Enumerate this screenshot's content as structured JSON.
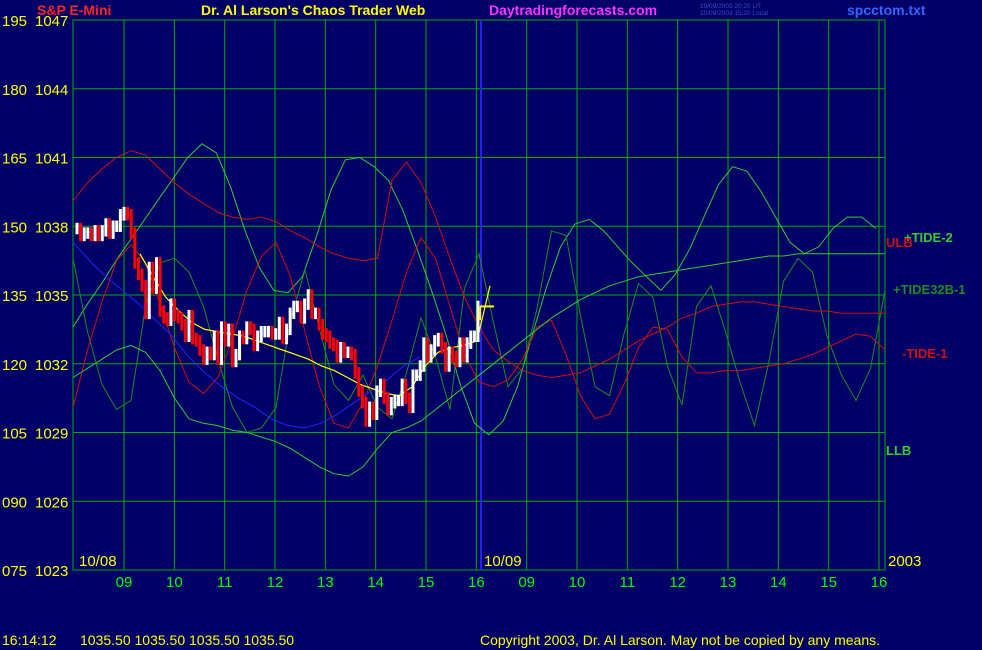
{
  "header": {
    "instrument": "S&P E-Mini",
    "title": "Dr. Al Larson's Chaos Trader Web",
    "site": "Daytradingforecasts.com",
    "timestamp_ut": "10/09/2003 20:20 UT",
    "timestamp_local": "10/09/2003 15:20 Local",
    "file": "spcctom.txt"
  },
  "footer": {
    "time": "16:14:12",
    "ohlc": "1035.50 1035.50 1035.50 1035.50",
    "copyright": "Copyright 2003, Dr. Al Larson. May not be copied by any means."
  },
  "colors": {
    "background": "#000066",
    "grid": "#00aa00",
    "axis_text": "#ffff00",
    "tick_text": "#00ff00",
    "price_up": "#ffffff",
    "price_down": "#ff0000",
    "tide_bright": "#33cc33",
    "tide_dark": "#1e8c1e",
    "ulb": "#cc1111",
    "today_line": "#2222ff",
    "instrument": "#ff2222",
    "site": "#ff33ff",
    "file": "#3366ff"
  },
  "chart_data": {
    "type": "line",
    "y_left_labels": [
      "195",
      "180",
      "165",
      "150",
      "135",
      "120",
      "105",
      "090",
      "075"
    ],
    "y_right_labels": [
      "1047",
      "1044",
      "1041",
      "1038",
      "1035",
      "1032",
      "1029",
      "1026",
      "1023"
    ],
    "ylim": [
      1023,
      1047
    ],
    "x_ticks": [
      "09",
      "10",
      "11",
      "12",
      "13",
      "14",
      "15",
      "16",
      "09",
      "10",
      "11",
      "12",
      "13",
      "14",
      "15",
      "16"
    ],
    "date_labels": [
      "10/08",
      "10/09"
    ],
    "year_label": "2003",
    "grid": true,
    "series": [
      {
        "name": "+TIDE-2",
        "color": "#33cc33",
        "values": [
          1033.6,
          1034.6,
          1035.5,
          1036.5,
          1037.4,
          1038.3,
          1039.2,
          1040.1,
          1041.0,
          1041.6,
          1041.2,
          1039.7,
          1037.8,
          1036.2,
          1035.2,
          1035.1,
          1035.8,
          1037.6,
          1039.6,
          1040.9,
          1041.0,
          1040.6,
          1040.0,
          1038.7,
          1037.0,
          1035.2,
          1033.3,
          1031.1,
          1029.4,
          1028.9,
          1029.5,
          1031.0,
          1033.2,
          1035.3,
          1037.1,
          1038.1,
          1038.3,
          1037.8,
          1037.1,
          1036.4,
          1035.8,
          1035.2,
          1035.9,
          1037.0,
          1038.4,
          1039.8,
          1040.6,
          1040.4,
          1039.5,
          1038.4,
          1037.3,
          1036.8,
          1037.1,
          1037.9,
          1038.4,
          1038.4,
          1037.9
        ]
      },
      {
        "name": "+TIDE32B-1",
        "color": "#1e8c1e",
        "values": [
          1036.6,
          1033.4,
          1031.1,
          1030.0,
          1030.4,
          1034.5,
          1036.4,
          1036.6,
          1036.0,
          1034.5,
          1032.2,
          1030.1,
          1029.0,
          1029.2,
          1030.1,
          1033.9,
          1036.1,
          1033.5,
          1031.1,
          1030.4,
          1031.5,
          1030.1,
          1029.6,
          1031.6,
          1034.0,
          1032.3,
          1030.0,
          1035.3,
          1036.8,
          1033.8,
          1031.0,
          1031.8,
          1034.4,
          1037.8,
          1037.6,
          1034.1,
          1031.0,
          1030.6,
          1033.3,
          1035.5,
          1034.9,
          1031.9,
          1030.2,
          1034.5,
          1035.4,
          1033.4,
          1031.2,
          1029.3,
          1032.1,
          1035.6,
          1036.6,
          1036.0,
          1033.2,
          1031.5,
          1030.4,
          1031.8,
          1035.2
        ]
      },
      {
        "name": "ULB",
        "color": "#cc1111",
        "values": [
          1039.1,
          1039.9,
          1040.5,
          1041.0,
          1041.3,
          1041.1,
          1040.5,
          1039.9,
          1039.4,
          1039.0,
          1038.6,
          1038.4,
          1038.3,
          1038.4,
          1038.2,
          1037.8,
          1037.5,
          1037.1,
          1036.8,
          1036.6,
          1036.5,
          1036.6,
          1040.0,
          1040.8,
          1039.9,
          1038.4,
          1036.6,
          1034.9,
          1033.6,
          1032.6,
          1032.1,
          1031.7,
          1031.5,
          1031.4,
          1031.5,
          1031.6,
          1031.9,
          1032.2,
          1032.6,
          1033.0,
          1033.3,
          1033.6,
          1034.0,
          1034.2,
          1034.5,
          1034.6,
          1034.7,
          1034.7,
          1034.6,
          1034.5,
          1034.4,
          1034.3,
          1034.3,
          1034.2,
          1034.2,
          1034.2,
          1034.2
        ]
      },
      {
        "name": "-TIDE-1",
        "color": "#cc1111",
        "values": [
          1030.1,
          1032.6,
          1034.7,
          1036.5,
          1037.2,
          1036.4,
          1034.6,
          1032.7,
          1031.2,
          1030.7,
          1031.4,
          1033.1,
          1035.2,
          1036.7,
          1037.3,
          1035.8,
          1033.4,
          1031.0,
          1029.4,
          1029.2,
          1030.3,
          1031.9,
          1033.9,
          1036.0,
          1037.5,
          1036.6,
          1034.5,
          1032.4,
          1031.2,
          1031.0,
          1031.3,
          1032.2,
          1033.6,
          1033.9,
          1032.4,
          1030.6,
          1029.6,
          1029.8,
          1031.1,
          1032.7,
          1033.6,
          1033.5,
          1032.3,
          1031.6,
          1031.6,
          1031.7,
          1031.7,
          1031.8,
          1031.9,
          1032.0,
          1032.2,
          1032.4,
          1032.7,
          1033.0,
          1033.3,
          1033.2,
          1032.6
        ]
      },
      {
        "name": "LLB",
        "color": "#33cc33",
        "values": [
          1031.4,
          1031.8,
          1032.2,
          1032.6,
          1032.8,
          1032.5,
          1031.7,
          1030.5,
          1029.6,
          1029.4,
          1029.3,
          1029.1,
          1029.0,
          1028.8,
          1028.6,
          1028.3,
          1027.9,
          1027.5,
          1027.2,
          1027.1,
          1027.5,
          1028.3,
          1029.0,
          1029.2,
          1029.5,
          1030.0,
          1030.5,
          1031.0,
          1031.5,
          1032.0,
          1032.5,
          1033.0,
          1033.5,
          1034.0,
          1034.4,
          1034.8,
          1035.1,
          1035.4,
          1035.6,
          1035.8,
          1035.9,
          1036.0,
          1036.1,
          1036.2,
          1036.3,
          1036.4,
          1036.5,
          1036.6,
          1036.7,
          1036.7,
          1036.8,
          1036.8,
          1036.8,
          1036.8,
          1036.8,
          1036.8,
          1036.8
        ]
      },
      {
        "name": "",
        "color": "#2222ff",
        "values": [
          1037.3,
          1036.5,
          1035.8,
          1035.2,
          1034.6,
          1033.9,
          1033.2,
          1032.3,
          1031.6,
          1031.0,
          1030.5,
          1030.1,
          1029.6,
          1029.3,
          1029.2,
          1029.4,
          1029.8,
          1030.3,
          1030.8,
          1031.3,
          1031.9,
          1032.3
        ]
      },
      {
        "name": "",
        "color": "#ffff00",
        "values": [
          1036.8,
          1035.8,
          1034.9,
          1034.3,
          1033.8,
          1033.5,
          1033.4,
          1033.3,
          1033.2,
          1033.0,
          1032.8,
          1032.6,
          1032.4,
          1032.2,
          1031.9,
          1031.7,
          1031.4,
          1031.1,
          1030.9,
          1030.7,
          1030.6,
          1031.0,
          1031.9,
          1032.5,
          1032.7,
          1032.8,
          1033.0,
          1035.4
        ]
      }
    ],
    "price_bars": {
      "up_color": "#ffffff",
      "down_color": "#ff0000",
      "closes": [
        1037.9,
        1037.6,
        1037.7,
        1037.7,
        1037.6,
        1037.8,
        1037.6,
        1037.8,
        1038.1,
        1037.7,
        1038.0,
        1038.0,
        1038.5,
        1038.6,
        1038.5,
        1037.7,
        1036.4,
        1035.9,
        1035.4,
        1034.2,
        1036.2,
        1035.3,
        1036.4,
        1034.3,
        1034.0,
        1033.9,
        1034.6,
        1034.1,
        1034.0,
        1033.7,
        1033.2,
        1034.1,
        1033.1,
        1033.0,
        1032.6,
        1032.2,
        1032.5,
        1032.4,
        1033.2,
        1032.2,
        1033.6,
        1033.0,
        1033.5,
        1032.1,
        1032.4,
        1033.2,
        1033.1,
        1033.6,
        1033.5,
        1032.8,
        1033.2,
        1033.4,
        1033.4,
        1033.4,
        1033.3,
        1033.3,
        1033.8,
        1033.1,
        1033.5,
        1034.2,
        1034.5,
        1034.5,
        1034.0,
        1034.6,
        1035.0,
        1034.2,
        1034.2,
        1033.7,
        1033.3,
        1033.2,
        1032.9,
        1032.8,
        1032.3,
        1032.7,
        1032.5,
        1032.5,
        1032.4,
        1031.6,
        1030.8,
        1030.3,
        1029.5,
        1030.1,
        1029.8,
        1030.8,
        1031.1,
        1030.5,
        1030.0,
        1030.3,
        1030.4,
        1030.4,
        1031.1,
        1030.5,
        1030.1,
        1031.5,
        1031.5,
        1031.9,
        1032.9,
        1032.3,
        1032.6,
        1033.0,
        1033.1,
        1032.7,
        1031.9,
        1032.5,
        1032.3,
        1032.1,
        1032.9,
        1032.3,
        1032.9,
        1033.2,
        1033.2,
        1034.5
      ]
    }
  }
}
